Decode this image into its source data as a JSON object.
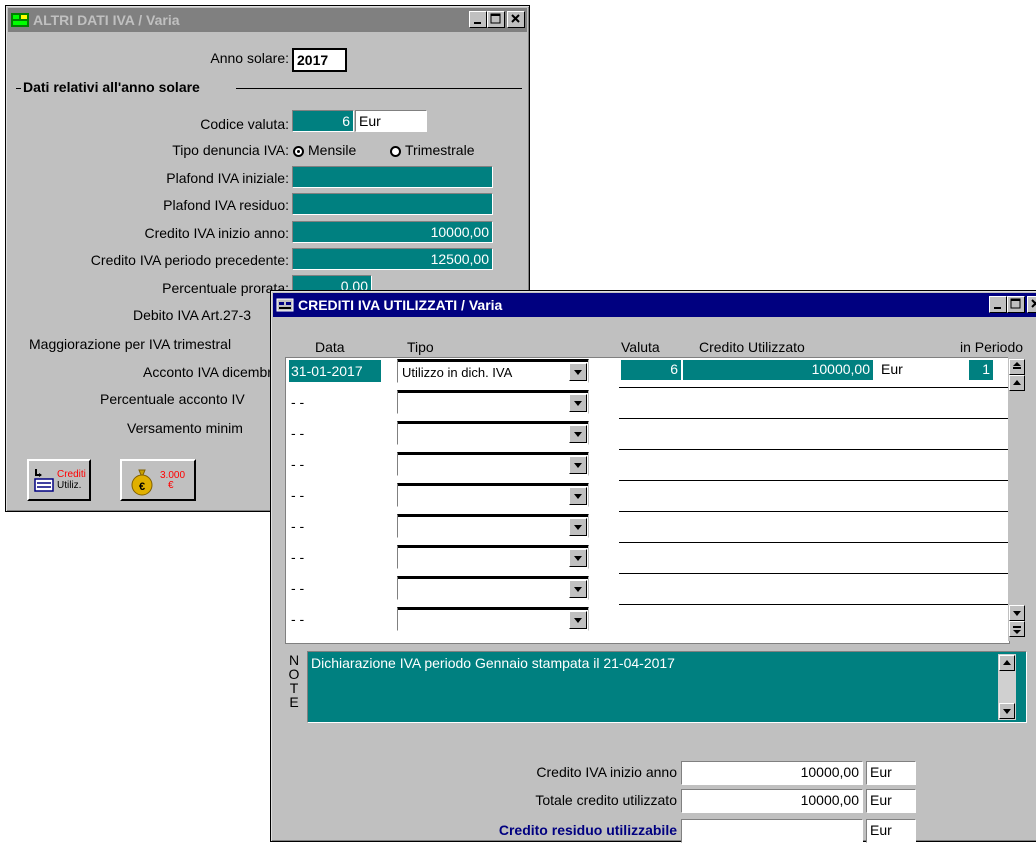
{
  "win1": {
    "title": "ALTRI DATI IVA / Varia",
    "anno_label": "Anno solare:",
    "anno_value": "2017",
    "section_title": "Dati relativi all'anno solare",
    "codice_valuta_label": "Codice valuta:",
    "codice_valuta_value": "6",
    "codice_valuta_code": "Eur",
    "tipo_denuncia_label": "Tipo denuncia IVA:",
    "radio_mensile": "Mensile",
    "radio_trimestrale": "Trimestrale",
    "plafond_iniziale_label": "Plafond IVA iniziale:",
    "plafond_residuo_label": "Plafond IVA residuo:",
    "credito_inizio_label": "Credito IVA inizio anno:",
    "credito_inizio_value": "10000,00",
    "credito_prec_label": "Credito IVA periodo precedente:",
    "credito_prec_value": "12500,00",
    "percentuale_prorata_label": "Percentuale prorata:",
    "percentuale_prorata_value": "0,00",
    "debito_label": "Debito IVA Art.27-3",
    "maggiorazione_label": "Maggiorazione per IVA trimestral",
    "acconto_label": "Acconto IVA dicembr",
    "perc_acconto_label": "Percentuale acconto IV",
    "versamento_label": "Versamento minim",
    "btn_crediti_l1": "Crediti",
    "btn_crediti_l2": "Utiliz.",
    "btn_coin_l1": "3.000",
    "btn_coin_l2": "€"
  },
  "win2": {
    "title": "CREDITI IVA UTILIZZATI / Varia",
    "col_data": "Data",
    "col_tipo": "Tipo",
    "col_valuta": "Valuta",
    "col_credito": "Credito Utilizzato",
    "col_periodo": "in Periodo",
    "rows": [
      {
        "data": "31-01-2017",
        "tipo": "Utilizzo in dich. IVA",
        "valuta": "6",
        "credito": "10000,00",
        "valuta_code": "Eur",
        "periodo": "1"
      },
      {
        "data": "- -",
        "tipo": ""
      },
      {
        "data": "- -",
        "tipo": ""
      },
      {
        "data": "- -",
        "tipo": ""
      },
      {
        "data": "- -",
        "tipo": ""
      },
      {
        "data": "- -",
        "tipo": ""
      },
      {
        "data": "- -",
        "tipo": ""
      },
      {
        "data": "- -",
        "tipo": ""
      },
      {
        "data": "- -",
        "tipo": ""
      }
    ],
    "note_label": "NOTE",
    "note_text": "Dichiarazione IVA periodo Gennaio stampata il 21-04-2017",
    "credito_inizio_label": "Credito IVA inizio anno",
    "credito_inizio_value": "10000,00",
    "credito_inizio_code": "Eur",
    "totale_label": "Totale credito utilizzato",
    "totale_value": "10000,00",
    "totale_code": "Eur",
    "residuo_label": "Credito residuo utilizzabile",
    "residuo_value": "",
    "residuo_code": "Eur"
  }
}
